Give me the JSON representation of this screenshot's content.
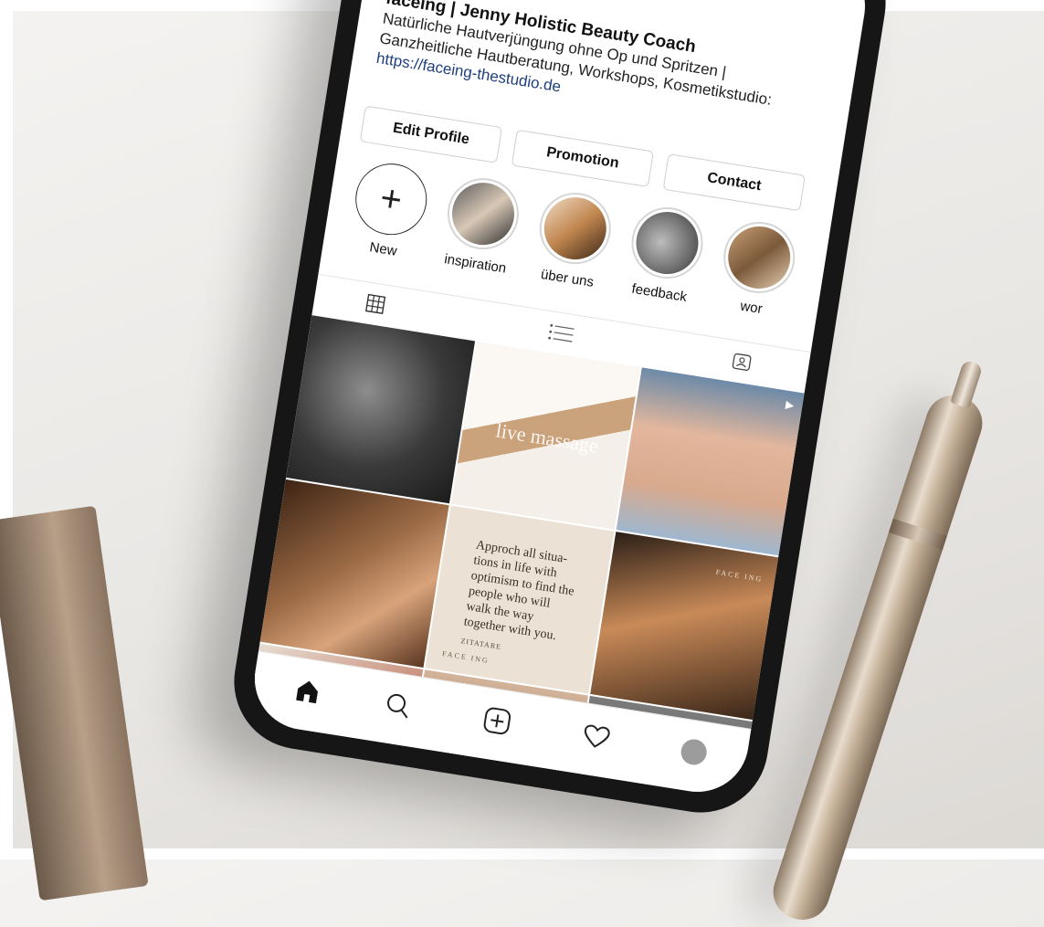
{
  "profile": {
    "name": "faceing | Jenny Holistic Beauty Coach",
    "bio_line1": "Natürliche Hautverjüngung ohne Op und Spritzen |",
    "bio_line2": "Ganzheitliche Hautberatung, Workshops, Kosmetikstudio:",
    "link": "https://faceing-thestudio.de"
  },
  "buttons": {
    "edit": "Edit Profile",
    "promotion": "Promotion",
    "contact": "Contact"
  },
  "highlights": [
    {
      "label": "New",
      "icon": "plus-icon"
    },
    {
      "label": "inspiration"
    },
    {
      "label": "über uns"
    },
    {
      "label": "feedback"
    },
    {
      "label": "wor"
    }
  ],
  "tabs": {
    "grid_icon": "grid-icon",
    "list_icon": "list-icon",
    "tagged_icon": "tagged-icon"
  },
  "posts": {
    "live_text": "live massage",
    "quote": "Approch all situa- tions in life with optimism to find the people who will walk the way together with you.",
    "quote_author": "ZITATARE",
    "brand": "FACE ING"
  },
  "bottom_nav": {
    "home": "home-icon",
    "search": "search-icon",
    "add": "add-post-icon",
    "activity": "heart-icon",
    "profile": "avatar"
  },
  "colors": {
    "link": "#1e3f7d",
    "phone": "#161616"
  }
}
